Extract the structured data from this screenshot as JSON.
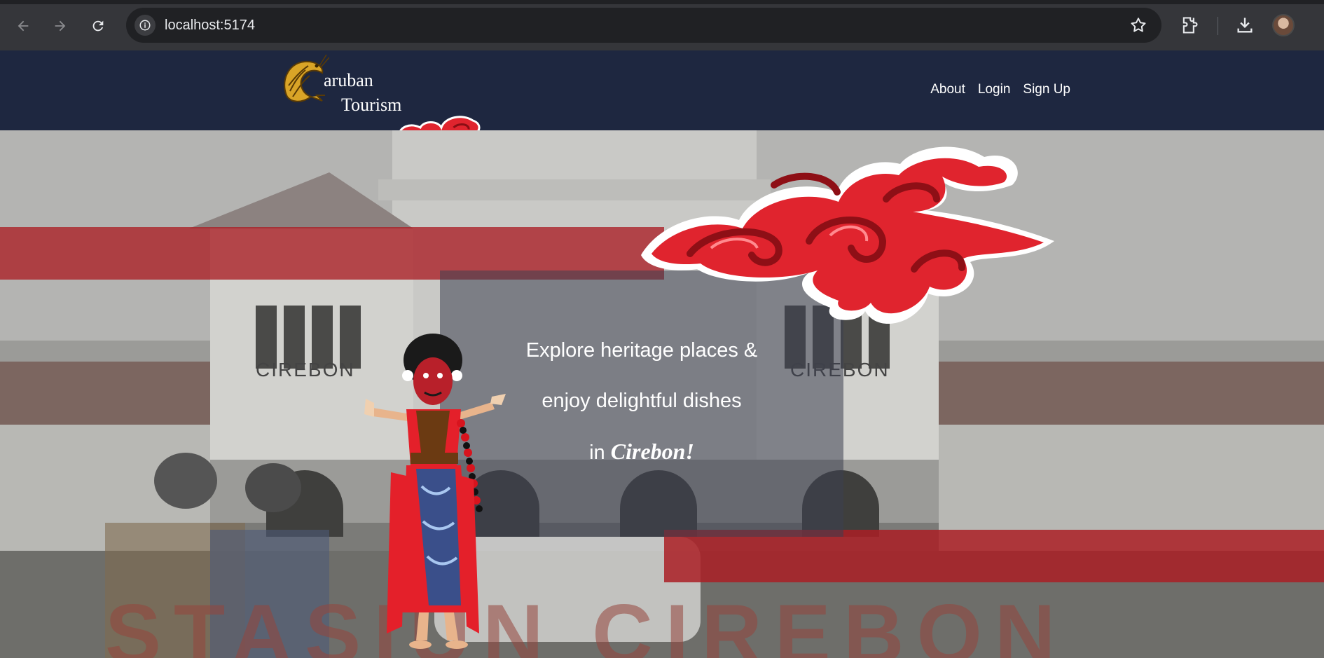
{
  "browser": {
    "url": "localhost:5174",
    "icons": [
      "back-arrow-icon",
      "forward-arrow-icon",
      "reload-icon",
      "site-info-icon",
      "bookmark-star-icon",
      "extensions-icon",
      "download-icon",
      "profile-avatar"
    ]
  },
  "site": {
    "brand_line1": "aruban",
    "brand_line2": "Tourism",
    "nav": {
      "about": "About",
      "login": "Login",
      "signup": "Sign Up"
    }
  },
  "hero": {
    "line1": "Explore heritage places &",
    "line2": "enjoy delightful dishes",
    "line3_prefix": "in ",
    "line3_highlight": "Cirebon!",
    "building_sign": "CIREBON",
    "ground_sign": "STASIUN CIREBON"
  },
  "colors": {
    "navbar": "#1e2740",
    "accent_red": "#aa1e24",
    "cloud_red": "#e0242e"
  }
}
